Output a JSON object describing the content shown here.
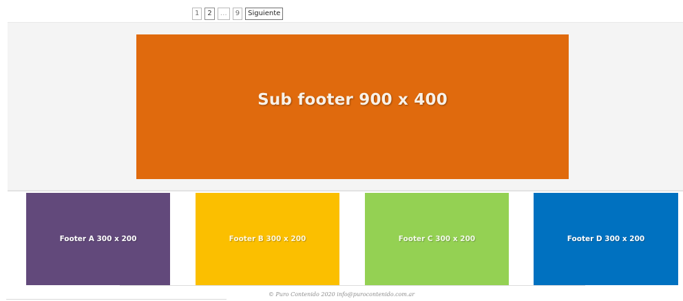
{
  "pagination": {
    "pages": [
      "1",
      "2",
      "…",
      "9"
    ],
    "next_label": "Siguiente"
  },
  "subfooter": {
    "banner_text": "Sub footer 900 x 400",
    "color": "#e06a0d"
  },
  "footers": [
    {
      "label": "Footer A 300 x 200",
      "color": "#62497b"
    },
    {
      "label": "Footer B 300 x 200",
      "color": "#fbbf00"
    },
    {
      "label": "Footer C 300 x 200",
      "color": "#94d153"
    },
    {
      "label": "Footer D 300 x 200",
      "color": "#0071c0"
    }
  ],
  "copyright": "© Puro Contenido 2020 info@purocontenido.com.ar"
}
